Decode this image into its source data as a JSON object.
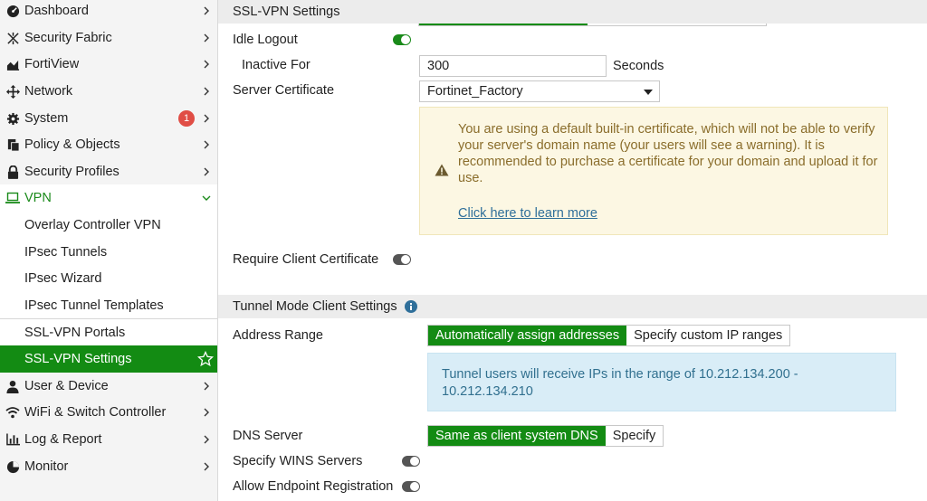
{
  "sidebar": {
    "items": [
      {
        "label": "Dashboard",
        "icon": "dashboard-icon",
        "chevron": "right"
      },
      {
        "label": "Security Fabric",
        "icon": "security-fabric-icon",
        "chevron": "right"
      },
      {
        "label": "FortiView",
        "icon": "fortiview-chart-icon",
        "chevron": "right"
      },
      {
        "label": "Network",
        "icon": "network-arrows-icon",
        "chevron": "right"
      },
      {
        "label": "System",
        "icon": "gear-icon",
        "chevron": "right",
        "badge": "1"
      },
      {
        "label": "Policy & Objects",
        "icon": "policy-objects-icon",
        "chevron": "right"
      },
      {
        "label": "Security Profiles",
        "icon": "lock-icon",
        "chevron": "right"
      },
      {
        "label": "VPN",
        "icon": "laptop-icon",
        "chevron": "down"
      }
    ],
    "vpn_sub": [
      {
        "label": "Overlay Controller VPN"
      },
      {
        "label": "IPsec Tunnels"
      },
      {
        "label": "IPsec Wizard"
      },
      {
        "label": "IPsec Tunnel Templates"
      },
      {
        "label": "SSL-VPN Portals"
      },
      {
        "label": "SSL-VPN Settings",
        "active": true
      }
    ],
    "bottom_items": [
      {
        "label": "User & Device",
        "icon": "user-icon",
        "chevron": "right"
      },
      {
        "label": "WiFi & Switch Controller",
        "icon": "wifi-icon",
        "chevron": "right"
      },
      {
        "label": "Log & Report",
        "icon": "bar-chart-icon",
        "chevron": "right"
      },
      {
        "label": "Monitor",
        "icon": "pie-chart-icon",
        "chevron": "right"
      }
    ],
    "colors": {
      "active_bg": "#138b13",
      "vpn_text": "#1a8a1a",
      "badge": "#e04d45"
    }
  },
  "main": {
    "header_title": "SSL-VPN Settings",
    "idle_logout": {
      "label": "Idle Logout",
      "enabled": true
    },
    "inactive_for": {
      "label": "Inactive For",
      "value": "300",
      "unit": "Seconds"
    },
    "server_certificate": {
      "label": "Server Certificate",
      "value": "Fortinet_Factory"
    },
    "cert_warning": {
      "message": "You are using a default built-in certificate, which will not be able to verify your server's domain name (your users will see a warning). It is recommended to purchase a certificate for your domain and upload it for use.",
      "link": "Click here to learn more"
    },
    "require_client_cert": {
      "label": "Require Client Certificate",
      "enabled": false
    },
    "tunnel_section_title": "Tunnel Mode Client Settings",
    "address_range": {
      "label": "Address Range",
      "options": [
        "Automatically assign addresses",
        "Specify custom IP ranges"
      ],
      "selected": "Automatically assign addresses"
    },
    "address_info": "Tunnel users will receive IPs in the range of 10.212.134.200 - 10.212.134.210",
    "dns_server": {
      "label": "DNS Server",
      "options": [
        "Same as client system DNS",
        "Specify"
      ],
      "selected": "Same as client system DNS"
    },
    "wins_servers": {
      "label": "Specify WINS Servers",
      "enabled": false
    },
    "endpoint_registration": {
      "label": "Allow Endpoint Registration",
      "enabled": false
    }
  }
}
